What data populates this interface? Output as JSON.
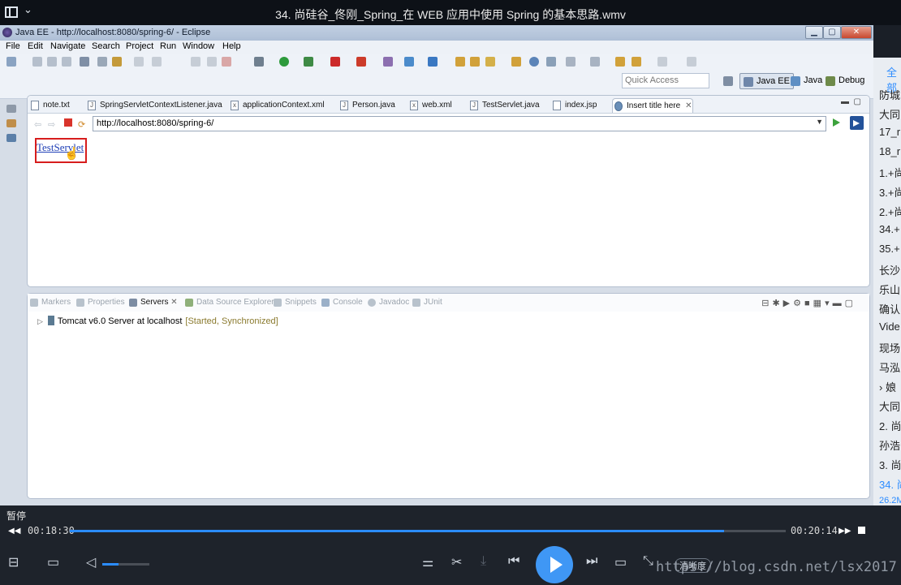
{
  "player": {
    "title": "34. 尚硅谷_佟刚_Spring_在 WEB 应用中使用 Spring 的基本思路.wmv",
    "pause_label": "暂停",
    "time_current": "00:18:30",
    "time_total": "00:20:14",
    "progress_fraction": 0.914,
    "volume_fraction": 0.35,
    "quality_label": "清晰度",
    "watermark": "https://blog.csdn.net/lsx2017"
  },
  "eclipse": {
    "window_title": "Java EE - http://localhost:8080/spring-6/ - Eclipse",
    "menu": [
      "File",
      "Edit",
      "Navigate",
      "Search",
      "Project",
      "Run",
      "Window",
      "Help"
    ],
    "quick_access_placeholder": "Quick Access",
    "perspectives": [
      "Java EE",
      "Java",
      "Debug"
    ],
    "editor_tabs": [
      {
        "label": "note.txt",
        "icon": "text-file-icon"
      },
      {
        "label": "SpringServletContextListener.java",
        "icon": "java-file-icon"
      },
      {
        "label": "applicationContext.xml",
        "icon": "xml-file-icon"
      },
      {
        "label": "Person.java",
        "icon": "java-file-icon"
      },
      {
        "label": "web.xml",
        "icon": "xml-file-icon"
      },
      {
        "label": "TestServlet.java",
        "icon": "java-file-icon"
      },
      {
        "label": "index.jsp",
        "icon": "jsp-file-icon"
      },
      {
        "label": "Insert title here",
        "icon": "globe-icon"
      }
    ],
    "browser": {
      "url": "http://localhost:8080/spring-6/",
      "page_link": "TestServlet"
    },
    "view_tabs": [
      "Markers",
      "Properties",
      "Servers",
      "Data Source Explorer",
      "Snippets",
      "Console",
      "Javadoc",
      "JUnit"
    ],
    "active_view": "Servers",
    "server": {
      "name": "Tomcat v6.0 Server at localhost",
      "status": "[Started, Synchronized]"
    }
  },
  "playlist": {
    "tab_label": "全部",
    "items": [
      "防城",
      "大同",
      "17_r",
      "18_r",
      "1.+尚",
      "3.+尚",
      "2.+尚",
      "34.+",
      "35.+",
      "长沙",
      "乐山",
      "确认",
      "Vide",
      "现场",
      "马泓",
      "娘",
      "大同",
      "2. 尚",
      "孙浩",
      "3. 尚",
      "34. 尚"
    ],
    "current_size": "26.2M"
  }
}
